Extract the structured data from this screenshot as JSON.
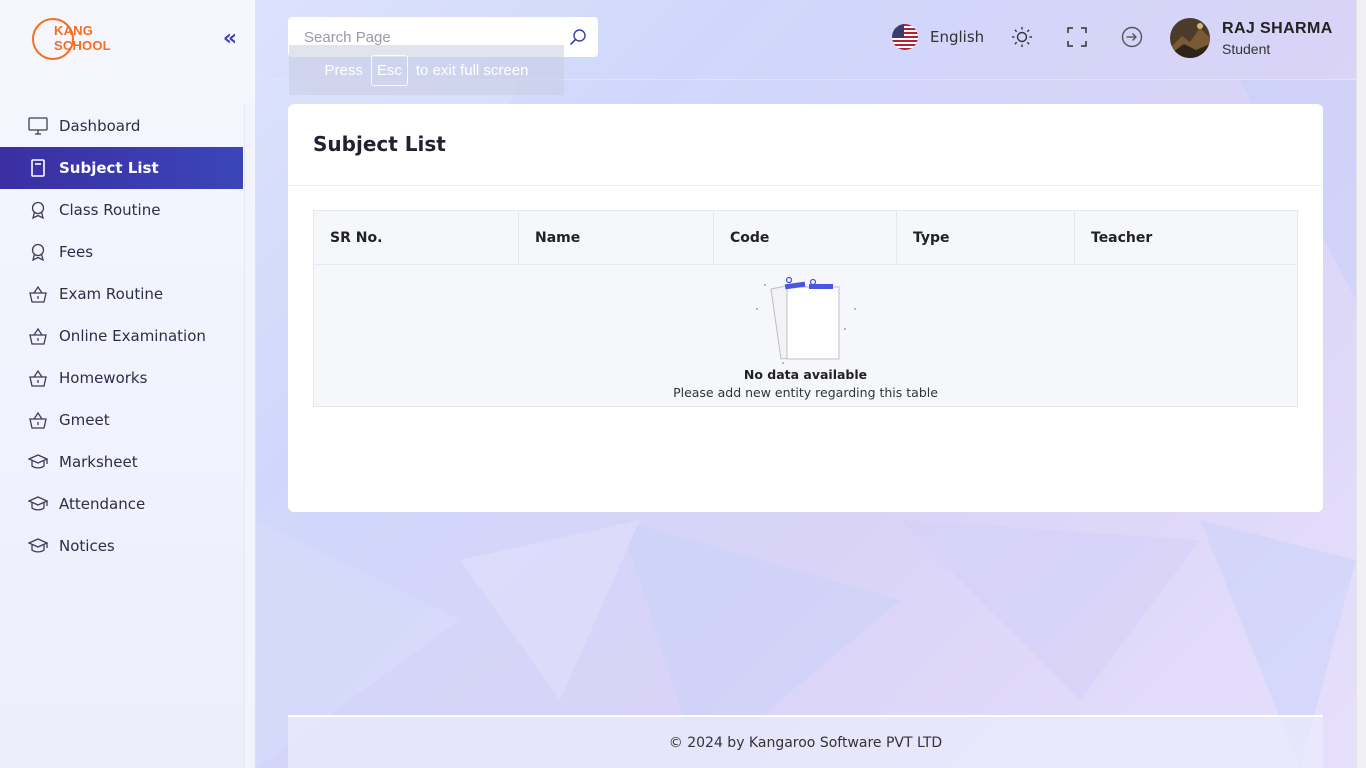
{
  "brand": {
    "line1": "KANG",
    "line2": "SCHOOL"
  },
  "search": {
    "placeholder": "Search Page"
  },
  "fullscreen_hint": {
    "prefix": "Press",
    "key": "Esc",
    "suffix": "to exit full screen"
  },
  "header": {
    "language": "English"
  },
  "user": {
    "name": "RAJ SHARMA",
    "role": "Student"
  },
  "sidebar": {
    "items": [
      {
        "label": "Dashboard",
        "icon": "monitor-icon"
      },
      {
        "label": "Subject List",
        "icon": "book-icon"
      },
      {
        "label": "Class Routine",
        "icon": "award-icon"
      },
      {
        "label": "Fees",
        "icon": "award-icon"
      },
      {
        "label": "Exam Routine",
        "icon": "basket-icon"
      },
      {
        "label": "Online Examination",
        "icon": "basket-icon"
      },
      {
        "label": "Homeworks",
        "icon": "basket-icon"
      },
      {
        "label": "Gmeet",
        "icon": "basket-icon"
      },
      {
        "label": "Marksheet",
        "icon": "graduation-cap-icon"
      },
      {
        "label": "Attendance",
        "icon": "graduation-cap-icon"
      },
      {
        "label": "Notices",
        "icon": "graduation-cap-icon"
      }
    ],
    "active_index": 1
  },
  "page": {
    "title": "Subject List",
    "table": {
      "columns": [
        "SR No.",
        "Name",
        "Code",
        "Type",
        "Teacher"
      ],
      "empty_title": "No data available",
      "empty_subtitle": "Please add new entity regarding this table"
    }
  },
  "footer": {
    "text": "© 2024 by Kangaroo Software PVT LTD"
  },
  "colors": {
    "accent": "#3b45b8",
    "brand": "#f36f21"
  }
}
